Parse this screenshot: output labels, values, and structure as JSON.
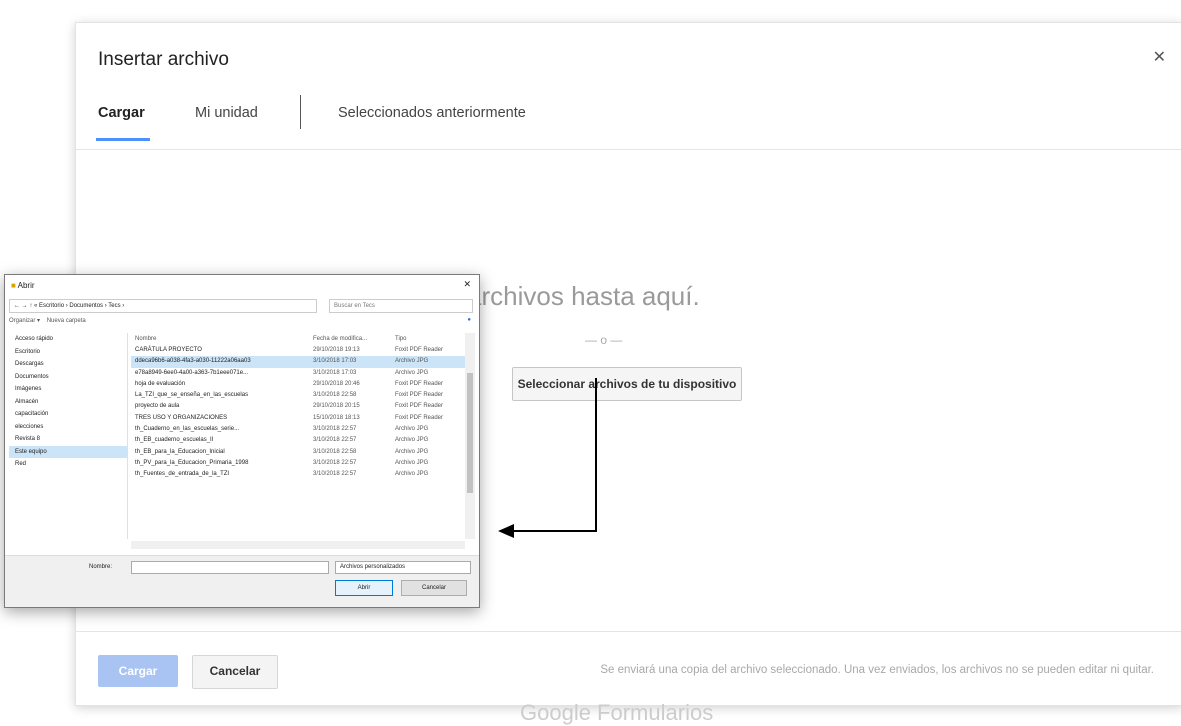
{
  "dialog": {
    "title": "Insertar archivo",
    "close_icon": "close-icon",
    "tabs": [
      {
        "label": "Cargar",
        "active": true
      },
      {
        "label": "Mi unidad",
        "active": false
      },
      {
        "label": "Seleccionados anteriormente",
        "active": false
      }
    ],
    "drop_text": "stra los archivos hasta aquí.",
    "or_text": "— o —",
    "select_button": "Seleccionar archivos de tu dispositivo",
    "upload_button": "Cargar",
    "cancel_button": "Cancelar",
    "footer_note": "Se enviará una copia del archivo seleccionado. Una vez enviados, los archivos no se pueden editar ni quitar.",
    "brand_footer": "Google Formularios"
  },
  "colors": {
    "accent": "#4d90fe",
    "upload_disabled": "#a9c3f2",
    "arrow": "#000000"
  },
  "win_dialog": {
    "title": "Abrir",
    "address": "« Escritorio › Documentos › Tecs ›",
    "search_placeholder": "Buscar en Tecs",
    "toolbar": {
      "organize": "Organizar ▾",
      "new_folder": "Nueva carpeta"
    },
    "nav_items": [
      {
        "label": "Acceso rápido",
        "selected": false
      },
      {
        "label": "Escritorio",
        "selected": false
      },
      {
        "label": "Descargas",
        "selected": false
      },
      {
        "label": "Documentos",
        "selected": false
      },
      {
        "label": "Imágenes",
        "selected": false
      },
      {
        "label": "Almacén",
        "selected": false
      },
      {
        "label": "capacitación",
        "selected": false
      },
      {
        "label": "elecciones",
        "selected": false
      },
      {
        "label": "Revista 8",
        "selected": false
      },
      {
        "label": "Este equipo",
        "selected": true
      },
      {
        "label": "Red",
        "selected": false
      }
    ],
    "columns": [
      "Nombre",
      "Fecha de modifica...",
      "Tipo"
    ],
    "rows": [
      {
        "name": "CARÁTULA PROYECTO",
        "date": "29/10/2018 19:13",
        "type": "Foxit PDF Reader",
        "selected": false
      },
      {
        "name": "ddeca96b6-a038-4fa3-a030-11222a06aa03",
        "date": "3/10/2018 17:03",
        "type": "Archivo JPG",
        "selected": true
      },
      {
        "name": "e78a8949-6ee0-4a00-a363-7b1eee071e...",
        "date": "3/10/2018 17:03",
        "type": "Archivo JPG",
        "selected": false
      },
      {
        "name": "hoja de evaluación",
        "date": "29/10/2018 20:46",
        "type": "Foxit PDF Reader",
        "selected": false
      },
      {
        "name": "La_TZI_que_se_enseña_en_las_escuelas",
        "date": "3/10/2018 22:58",
        "type": "Foxit PDF Reader",
        "selected": false
      },
      {
        "name": "proyecto de aula",
        "date": "29/10/2018 20:15",
        "type": "Foxit PDF Reader",
        "selected": false
      },
      {
        "name": "TRES USO Y ORGANIZACIONES",
        "date": "15/10/2018 18:13",
        "type": "Foxit PDF Reader",
        "selected": false
      },
      {
        "name": "th_Cuaderno_en_las_escuelas_serie...",
        "date": "3/10/2018 22:57",
        "type": "Archivo JPG",
        "selected": false
      },
      {
        "name": "th_EB_cuaderno_escuelas_II",
        "date": "3/10/2018 22:57",
        "type": "Archivo JPG",
        "selected": false
      },
      {
        "name": "th_EB_para_la_Educacion_Inicial",
        "date": "3/10/2018 22:58",
        "type": "Archivo JPG",
        "selected": false
      },
      {
        "name": "th_PV_para_la_Educacion_Primaria_1998",
        "date": "3/10/2018 22:57",
        "type": "Archivo JPG",
        "selected": false
      },
      {
        "name": "th_Fuentes_de_entrada_de_la_TZI",
        "date": "3/10/2018 22:57",
        "type": "Archivo JPG",
        "selected": false
      }
    ],
    "filename_label": "Nombre:",
    "filename_value": "",
    "filetype": "Archivos personalizados",
    "open_button": "Abrir",
    "cancel_button": "Cancelar"
  }
}
